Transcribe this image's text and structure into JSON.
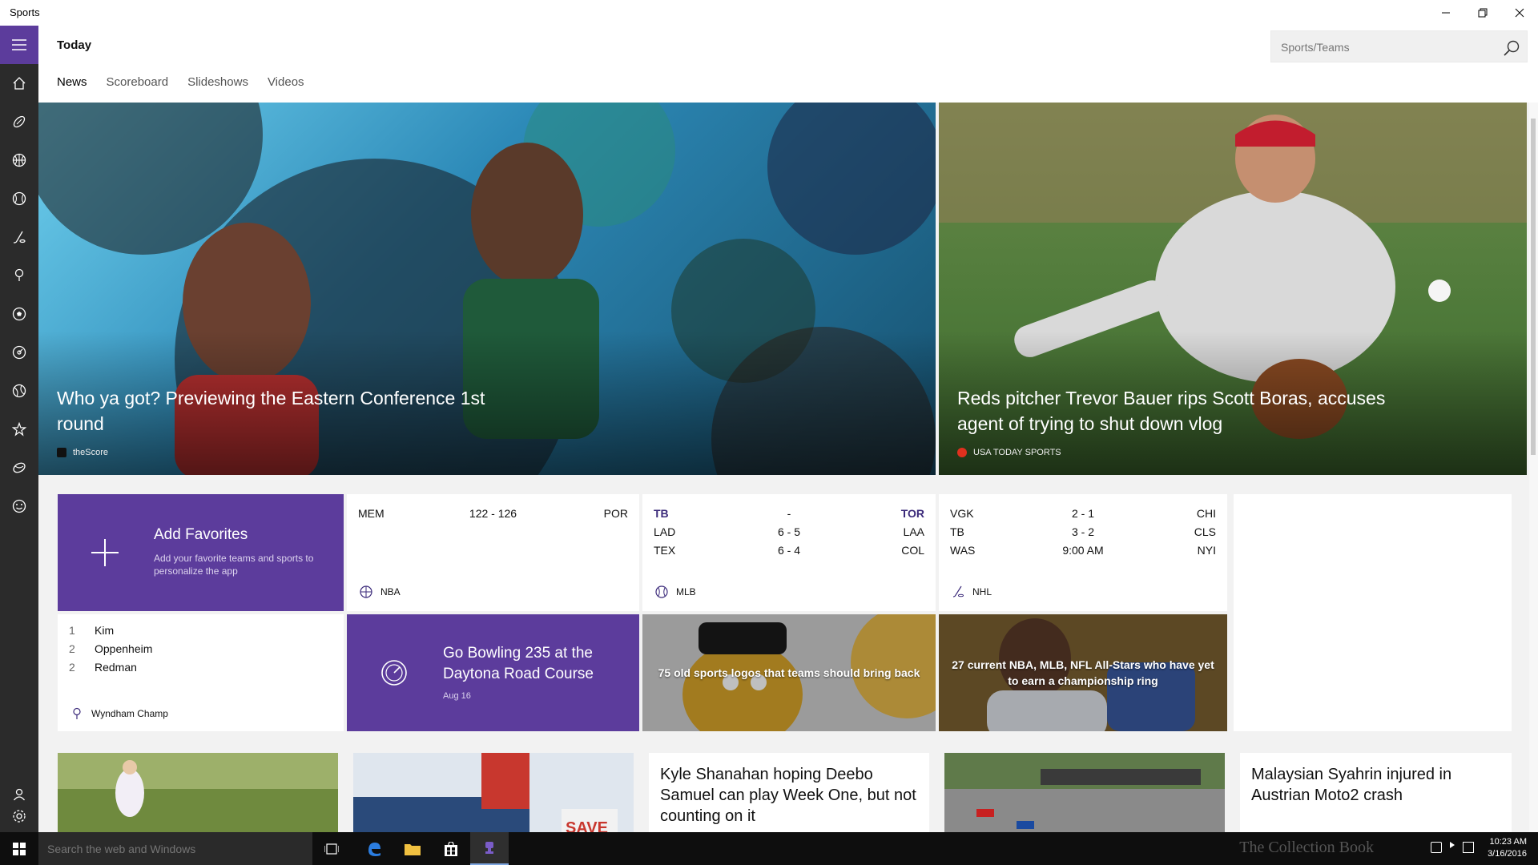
{
  "window": {
    "title": "Sports"
  },
  "header": {
    "page_title": "Today",
    "search_placeholder": "Sports/Teams"
  },
  "tabs": [
    {
      "label": "News",
      "active": true
    },
    {
      "label": "Scoreboard"
    },
    {
      "label": "Slideshows"
    },
    {
      "label": "Videos"
    }
  ],
  "rail_icons": [
    "home-icon",
    "football-icon",
    "basketball-icon",
    "baseball-icon",
    "hockey-icon",
    "golf-icon",
    "soccer-icon",
    "racing-icon",
    "tennis-icon",
    "favorites-star-icon",
    "rugby-icon",
    "more-sports-icon",
    "account-icon",
    "settings-icon"
  ],
  "hero": [
    {
      "headline": "Who ya got? Previewing the Eastern Conference 1st round",
      "source": "theScore"
    },
    {
      "headline": "Reds pitcher Trevor Bauer rips Scott Boras, accuses agent of trying to shut down vlog",
      "source": "USA TODAY SPORTS"
    }
  ],
  "favorites": {
    "title": "Add Favorites",
    "description": "Add your favorite teams and sports to personalize the app"
  },
  "scores": [
    {
      "league": "NBA",
      "games": [
        {
          "team1": "MEM",
          "score": "122  -  126",
          "team2": "POR"
        }
      ]
    },
    {
      "league": "MLB",
      "games": [
        {
          "team1": "TB",
          "score": "-",
          "team2": "TOR",
          "highlight": true
        },
        {
          "team1": "LAD",
          "score": "6  -  5",
          "team2": "LAA"
        },
        {
          "team1": "TEX",
          "score": "6  -  4",
          "team2": "COL"
        }
      ]
    },
    {
      "league": "NHL",
      "games": [
        {
          "team1": "VGK",
          "score": "2  -  1",
          "team2": "CHI"
        },
        {
          "team1": "TB",
          "score": "3  -  2",
          "team2": "CLS"
        },
        {
          "team1": "WAS",
          "score": "9:00 AM",
          "team2": "NYI"
        }
      ]
    }
  ],
  "leaderboard": {
    "rows": [
      {
        "pos": "1",
        "name": "Kim"
      },
      {
        "pos": "2",
        "name": "Oppenheim"
      },
      {
        "pos": "2",
        "name": "Redman"
      }
    ],
    "event": "Wyndham Champ"
  },
  "race": {
    "title": "Go Bowling 235 at the Daytona Road Course",
    "date": "Aug 16"
  },
  "photo_stories": [
    "75 old sports logos that teams should bring back",
    "27 current NBA, MLB, NFL All-Stars who have yet to earn a championship ring"
  ],
  "bottom_cards": [
    "",
    "",
    "Kyle Shanahan hoping Deebo Samuel can play Week One, but not counting on it",
    "",
    "Malaysian Syahrin injured in Austrian Moto2 crash"
  ],
  "taskbar": {
    "search_placeholder": "Search the web and Windows",
    "time": "10:23 AM",
    "date": "3/16/2016",
    "watermark": "The Collection Book"
  },
  "colors": {
    "accent": "#5c3c9c",
    "rail": "#2b2b2b",
    "taskbar": "#0e0e0e"
  }
}
